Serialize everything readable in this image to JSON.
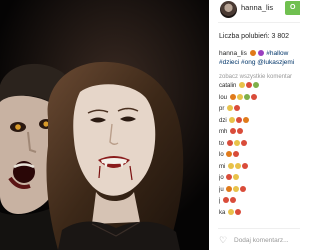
{
  "post": {
    "username": "hanna_lis",
    "follow_label": "O",
    "likes_text": "Liczba polubień: 3 802",
    "caption_user": "hanna_lis",
    "caption_tags": [
      "#hallow",
      "#dzieci #ong @lukaszjemi"
    ],
    "view_all": "zobacz wszystkie komentar",
    "add_comment_placeholder": "Dodaj komentarz...",
    "comments": [
      {
        "user": "catalin",
        "text": ""
      },
      {
        "user": "lou",
        "text": ""
      },
      {
        "user": "pr",
        "text": ""
      },
      {
        "user": "dzi",
        "text": ""
      },
      {
        "user": "mh",
        "text": ""
      },
      {
        "user": "to",
        "text": ""
      },
      {
        "user": "lo",
        "text": ""
      },
      {
        "user": "mi",
        "text": ""
      },
      {
        "user": "jo",
        "text": ""
      },
      {
        "user": "ju",
        "text": ""
      },
      {
        "user": "j",
        "text": ""
      },
      {
        "user": "ka",
        "text": ""
      }
    ]
  },
  "colors": {
    "follow_bg": "#70c050",
    "hashtag": "#003569",
    "muted": "#999999"
  },
  "icons": {
    "like": "heart-outline-icon"
  }
}
